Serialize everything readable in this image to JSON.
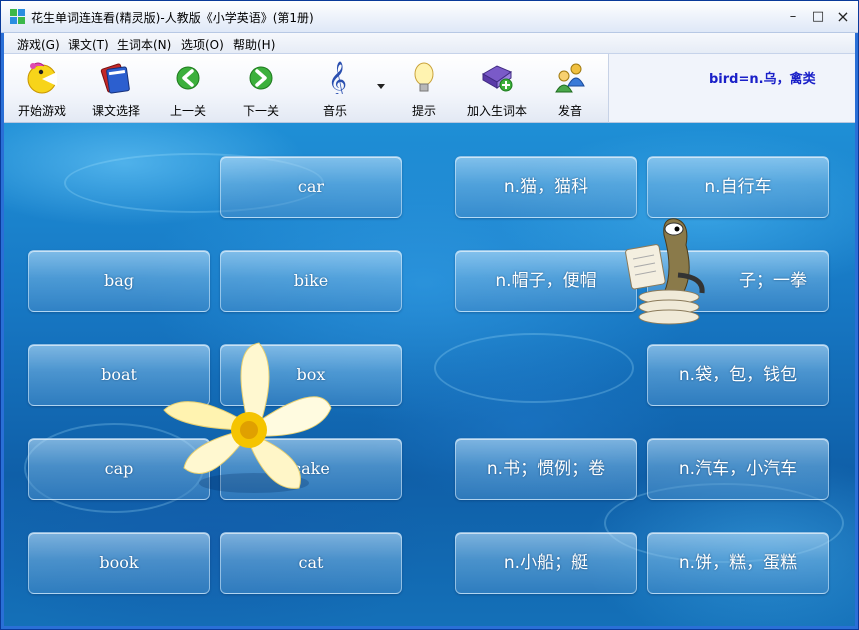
{
  "window": {
    "title": "花生单词连连看(精灵版)-人教版《小学英语》(第1册)",
    "controls": {
      "minimize": "–",
      "maximize": "□",
      "close": "×"
    }
  },
  "menu": {
    "items": [
      {
        "label": "游戏(G)"
      },
      {
        "label": "课文(T)"
      },
      {
        "label": "生词本(N)"
      },
      {
        "label": "选项(O)"
      },
      {
        "label": "帮助(H)"
      }
    ]
  },
  "toolbar": {
    "items": [
      {
        "label": "开始游戏",
        "icon": "pacman-icon"
      },
      {
        "label": "课文选择",
        "icon": "books-icon"
      },
      {
        "label": "上一关",
        "icon": "arrow-left-icon"
      },
      {
        "label": "下一关",
        "icon": "arrow-right-icon"
      },
      {
        "label": "音乐",
        "icon": "treble-clef-icon"
      },
      {
        "label": "提示",
        "icon": "lightbulb-icon"
      },
      {
        "label": "加入生词本",
        "icon": "add-book-icon"
      },
      {
        "label": "发音",
        "icon": "speaker-people-icon"
      }
    ]
  },
  "info": {
    "text": "bird=n.乌，禽类"
  },
  "board": {
    "cards": [
      {
        "text": "car"
      },
      {
        "text": "n.猫，猫科"
      },
      {
        "text": "n.自行车"
      },
      {
        "text": "bag"
      },
      {
        "text": "bike"
      },
      {
        "text": "n.帽子，便帽"
      },
      {
        "text": "子；一拳"
      },
      {
        "text": "boat"
      },
      {
        "text": "box"
      },
      {
        "text": "n.袋，包，钱包"
      },
      {
        "text": "cap"
      },
      {
        "text": "cake"
      },
      {
        "text": "n.书；惯例；卷"
      },
      {
        "text": "n.汽车，小汽车"
      },
      {
        "text": "book"
      },
      {
        "text": "cat"
      },
      {
        "text": "n.小船；艇"
      },
      {
        "text": "n.饼，糕，蛋糕"
      }
    ]
  },
  "colors": {
    "info_text": "#1a20c8",
    "water": "#1778c4",
    "card_text": "#ffffff"
  }
}
